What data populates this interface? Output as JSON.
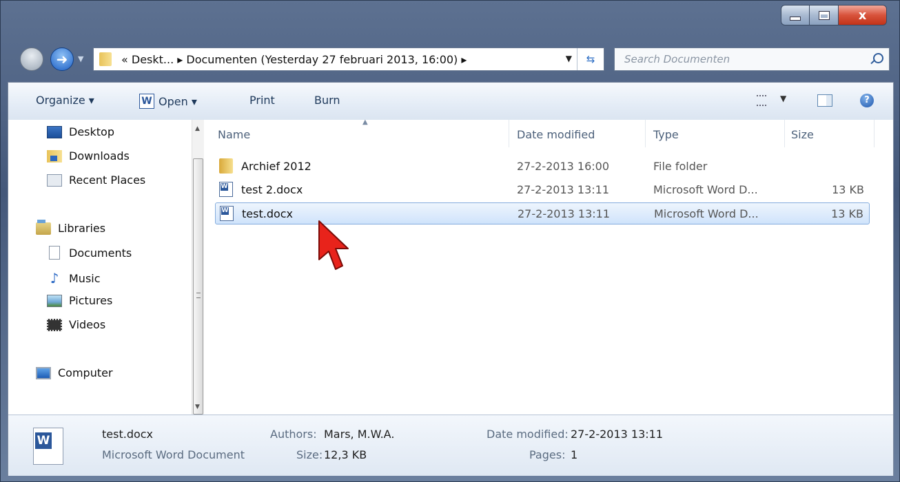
{
  "address_bar": {
    "path_text": "« Deskt... ▸ Documenten (Yesterday 27 februari 2013, 16:00) ▸"
  },
  "search": {
    "placeholder": "Search Documenten"
  },
  "window_controls": {
    "close_label": "x"
  },
  "toolbar": {
    "organize_label": "Organize ▾",
    "open_label": "Open ▾",
    "print_label": "Print",
    "burn_label": "Burn"
  },
  "nav_pane": {
    "items": [
      {
        "label": "Desktop",
        "icon": "desktop-icon"
      },
      {
        "label": "Downloads",
        "icon": "downloads-folder-icon"
      },
      {
        "label": "Recent Places",
        "icon": "recent-places-icon"
      },
      {
        "label": "Libraries",
        "icon": "libraries-icon"
      },
      {
        "label": "Documents",
        "icon": "documents-icon"
      },
      {
        "label": "Music",
        "icon": "music-icon"
      },
      {
        "label": "Pictures",
        "icon": "pictures-icon"
      },
      {
        "label": "Videos",
        "icon": "videos-icon"
      },
      {
        "label": "Computer",
        "icon": "computer-icon"
      }
    ]
  },
  "file_list": {
    "columns": [
      "Name",
      "Date modified",
      "Type",
      "Size"
    ],
    "rows": [
      {
        "name": "Archief 2012",
        "date": "27-2-2013 16:00",
        "type": "File folder",
        "size": "",
        "icon": "folder-icon"
      },
      {
        "name": "test 2.docx",
        "date": "27-2-2013 13:11",
        "type": "Microsoft Word D...",
        "size": "13 KB",
        "icon": "word-document-icon"
      },
      {
        "name": "test.docx",
        "date": "27-2-2013 13:11",
        "type": "Microsoft Word D...",
        "size": "13 KB",
        "icon": "word-document-icon",
        "selected": true
      }
    ]
  },
  "details": {
    "file_name": "test.docx",
    "file_type": "Microsoft Word Document",
    "authors_label": "Authors:",
    "authors_value": "Mars, M.W.A.",
    "size_label": "Size:",
    "size_value": "12,3 KB",
    "date_label": "Date modified:",
    "date_value": "27-2-2013 13:11",
    "pages_label": "Pages:",
    "pages_value": "1"
  },
  "colors": {
    "selection_border": "#84acdd",
    "cursor": "#e8231b",
    "close_button": "#c8381d"
  }
}
